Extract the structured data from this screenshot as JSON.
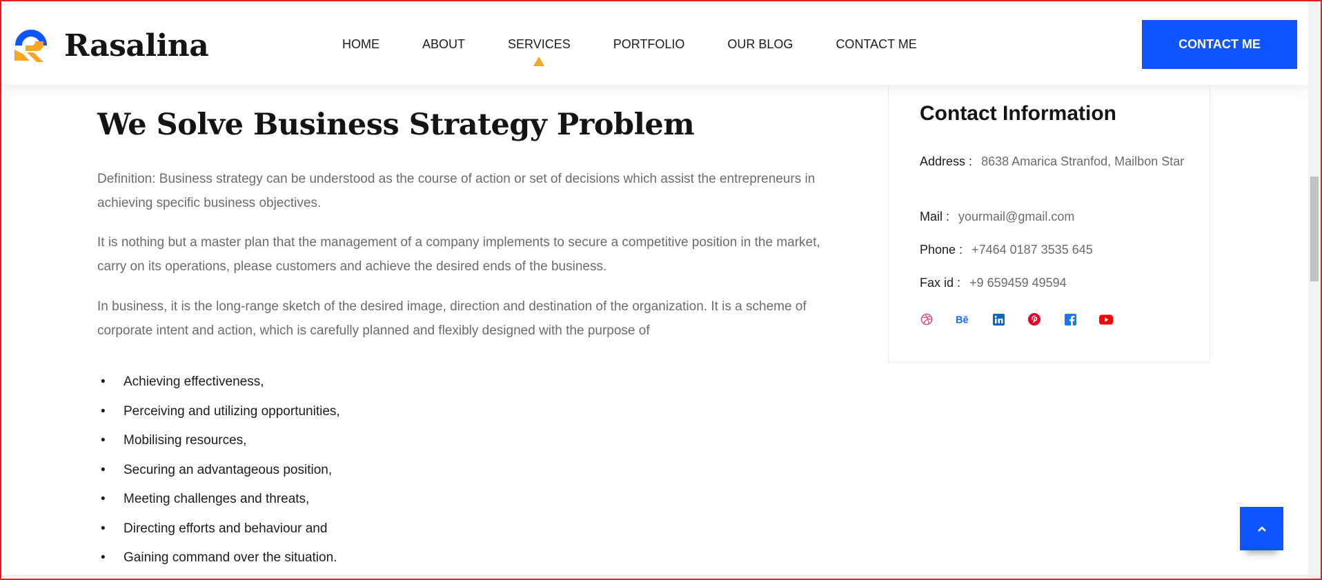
{
  "brand": {
    "name": "Rasalina",
    "logo_colors": {
      "blue": "#0f55ff",
      "orange": "#f5a623"
    }
  },
  "nav": {
    "items": [
      {
        "label": "HOME"
      },
      {
        "label": "ABOUT"
      },
      {
        "label": "SERVICES",
        "active": true
      },
      {
        "label": "PORTFOLIO"
      },
      {
        "label": "OUR BLOG"
      },
      {
        "label": "CONTACT ME"
      }
    ],
    "cta_label": "CONTACT ME"
  },
  "main": {
    "title": "We Solve Business Strategy Problem",
    "paragraphs": [
      "Definition: Business strategy can be understood as the course of action or set of decisions which assist the entrepreneurs in achieving specific business objectives.",
      "It is nothing but a master plan that the management of a company implements to secure a competitive position in the market, carry on its operations, please customers and achieve the desired ends of the business.",
      "In business, it is the long-range sketch of the desired image, direction and destination of the organization. It is a scheme of corporate intent and action, which is carefully planned and flexibly designed with the purpose of"
    ],
    "bullets": [
      "Achieving effectiveness,",
      "Perceiving and utilizing opportunities,",
      "Mobilising resources,",
      "Securing an advantageous position,",
      "Meeting challenges and threats,",
      "Directing efforts and behaviour and",
      "Gaining command over the situation."
    ]
  },
  "contact": {
    "title": "Contact Information",
    "address_label": "Address :",
    "address_value": "8638 Amarica Stranfod, Mailbon Star",
    "mail_label": "Mail :",
    "mail_value": "yourmail@gmail.com",
    "phone_label": "Phone :",
    "phone_value": "+7464 0187 3535 645",
    "fax_label": "Fax id :",
    "fax_value": "+9 659459 49594",
    "socials": [
      {
        "icon": "dribbble-icon",
        "color": "#ea4c89"
      },
      {
        "icon": "behance-icon",
        "color": "#1769ff"
      },
      {
        "icon": "linkedin-icon",
        "color": "#0a66c2"
      },
      {
        "icon": "pinterest-icon",
        "color": "#e60023"
      },
      {
        "icon": "facebook-icon",
        "color": "#1877f2"
      },
      {
        "icon": "youtube-icon",
        "color": "#ff0000"
      }
    ]
  },
  "colors": {
    "accent": "#0f55ff",
    "active_caret": "#f5a623"
  }
}
